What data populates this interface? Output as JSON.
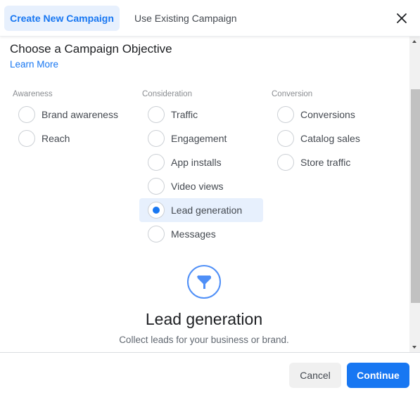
{
  "header": {
    "tabs": [
      {
        "label": "Create New Campaign",
        "active": true
      },
      {
        "label": "Use Existing Campaign",
        "active": false
      }
    ],
    "close_icon": "close-icon"
  },
  "content": {
    "title": "Choose a Campaign Objective",
    "learn_more": "Learn More",
    "columns": [
      {
        "label": "Awareness",
        "options": [
          "Brand awareness",
          "Reach"
        ]
      },
      {
        "label": "Consideration",
        "options": [
          "Traffic",
          "Engagement",
          "App installs",
          "Video views",
          "Lead generation",
          "Messages"
        ]
      },
      {
        "label": "Conversion",
        "options": [
          "Conversions",
          "Catalog sales",
          "Store traffic"
        ]
      }
    ],
    "selected": "Lead generation",
    "detail": {
      "icon": "funnel-icon",
      "title": "Lead generation",
      "description": "Collect leads for your business or brand."
    }
  },
  "footer": {
    "cancel_label": "Cancel",
    "continue_label": "Continue"
  },
  "colors": {
    "accent": "#1877f2",
    "selected_bg": "#e7f0fd"
  }
}
